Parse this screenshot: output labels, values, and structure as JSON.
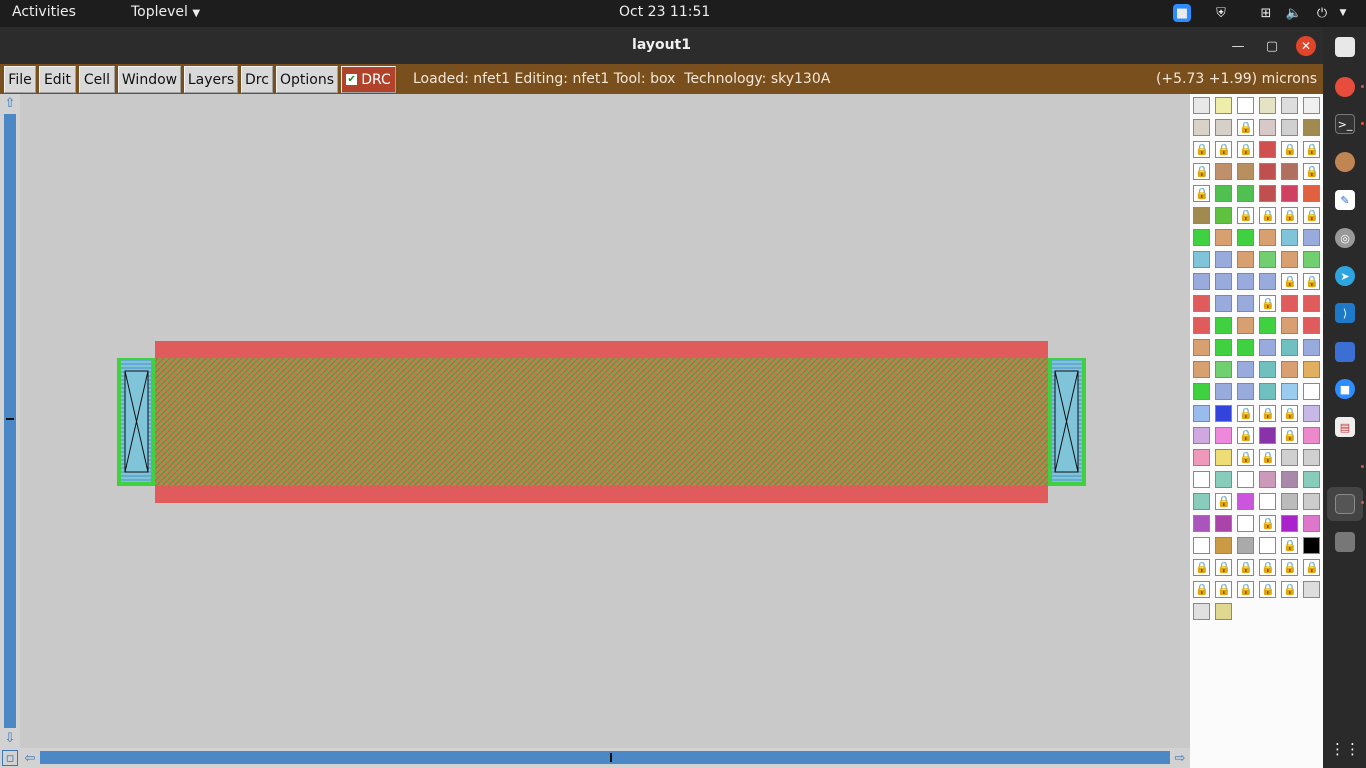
{
  "topbar": {
    "activities": "Activities",
    "app_menu": "Toplevel",
    "datetime": "Oct 23  11:51"
  },
  "window": {
    "title": "layout1"
  },
  "menubar": {
    "items": [
      "File",
      "Edit",
      "Cell",
      "Window",
      "Layers",
      "Drc",
      "Options"
    ],
    "drc_toggle": "DRC",
    "status": "Loaded: nfet1 Editing: nfet1 Tool: box  Technology: sky130A",
    "coordinates": "(+5.73 +1.99) microns"
  },
  "colors": {
    "menubar_bg": "#7a4f1e",
    "scroll_thumb": "#4c88c6",
    "poly": "#e05c5c",
    "diffusion": "#3fd13f",
    "canvas_bg": "#c9c9c9"
  },
  "icons": {
    "zoom": "video-camera-icon",
    "shield": "shield-icon",
    "network": "network-icon",
    "volume": "speaker-muted-icon",
    "power": "power-icon"
  }
}
